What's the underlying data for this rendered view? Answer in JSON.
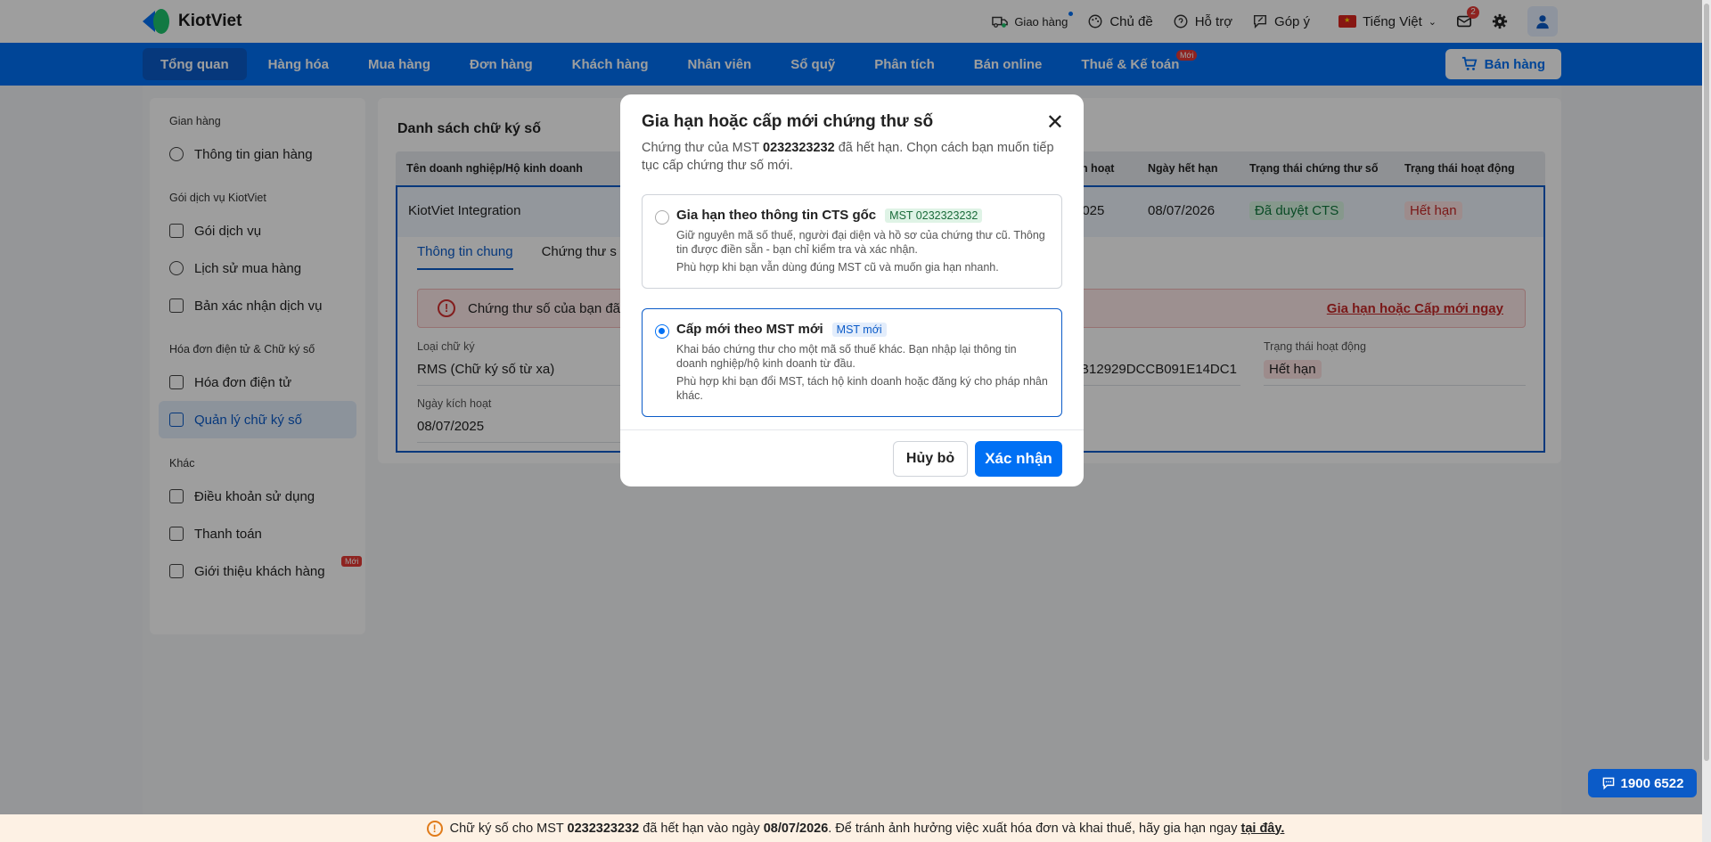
{
  "header": {
    "logo_text": "KiotViet",
    "delivery_label": "Giao hàng",
    "theme_label": "Chủ đề",
    "support_label": "Hỗ trợ",
    "feedback_label": "Góp ý",
    "language_label": "Tiếng Việt",
    "mail_count": "2"
  },
  "nav": {
    "items": [
      {
        "label": "Tổng quan"
      },
      {
        "label": "Hàng hóa"
      },
      {
        "label": "Mua hàng"
      },
      {
        "label": "Đơn hàng"
      },
      {
        "label": "Khách hàng"
      },
      {
        "label": "Nhân viên"
      },
      {
        "label": "Sổ quỹ"
      },
      {
        "label": "Phân tích"
      },
      {
        "label": "Bán online"
      },
      {
        "label": "Thuế & Kế toán",
        "badge": "Mới"
      }
    ],
    "sell_button": "Bán hàng"
  },
  "sidebar": {
    "groups": [
      {
        "title": "Gian hàng",
        "items": [
          "Thông tin gian hàng"
        ]
      },
      {
        "title": "Gói dịch vụ KiotViet",
        "items": [
          "Gói dịch vụ",
          "Lịch sử mua hàng",
          "Bản xác nhận dịch vụ"
        ]
      },
      {
        "title": "Hóa đơn điện tử & Chữ ký số",
        "items": [
          "Hóa đơn điện tử",
          "Quản lý chữ ký số"
        ]
      },
      {
        "title": "Khác",
        "items": [
          "Điều khoản sử dụng",
          "Thanh toán",
          "Giới thiệu khách hàng"
        ]
      }
    ],
    "new_badge": "Mới"
  },
  "main": {
    "title": "Danh sách chữ ký số",
    "columns": {
      "company": "Tên doanh nghiệp/Hộ kinh doanh",
      "activated": "ch hoạt",
      "expiry": "Ngày hết hạn",
      "cert_status": "Trạng thái chứng thư số",
      "active_status": "Trạng thái hoạt động"
    },
    "row": {
      "company": "KiotViet Integration",
      "activated": "2025",
      "expiry": "08/07/2026",
      "cert_status": "Đã duyệt CTS",
      "active_status": "Hết hạn"
    },
    "tabs": [
      "Thông tin chung",
      "Chứng thư s"
    ],
    "alert_text": "Chứng thư số của bạn đã",
    "alert_link": "Gia hạn hoặc Cấp mới ngay",
    "fields": {
      "type_label": "Loại chữ ký",
      "type_value": "RMS (Chữ ký số từ xa)",
      "serial_value": "B12929DCCB091E14DC1",
      "status_label": "Trạng thái hoạt động",
      "status_value": "Hết hạn",
      "activated_label": "Ngày kích hoạt",
      "activated_value": "08/07/2025"
    }
  },
  "modal": {
    "title": "Gia hạn hoặc cấp mới chứng thư số",
    "desc_prefix": "Chứng thư của MST ",
    "desc_mst": "0232323232",
    "desc_suffix": " đã hết hạn. Chọn cách bạn muốn tiếp tục cấp chứng thư số mới.",
    "option1": {
      "title": "Gia hạn theo thông tin CTS gốc",
      "tag": "MST 0232323232",
      "text": "Giữ nguyên mã số thuế, người đại diện và hồ sơ của chứng thư cũ. Thông tin được điền sẵn - bạn chỉ kiểm tra và xác nhận.",
      "note": "Phù hợp khi bạn vẫn dùng đúng MST cũ và muốn gia hạn nhanh.",
      "selected": false
    },
    "option2": {
      "title": "Cấp mới theo MST mới",
      "tag": "MST mới",
      "text": "Khai báo chứng thư cho một mã số thuế khác. Bạn nhập lại thông tin doanh nghiệp/hộ kinh doanh từ đầu.",
      "note": "Phù hợp khi bạn đổi MST, tách hộ kinh doanh hoặc đăng ký cho pháp nhân khác.",
      "selected": true
    },
    "cancel_label": "Hủy bỏ",
    "confirm_label": "Xác nhận"
  },
  "warning_bar": {
    "prefix": "Chữ ký số cho MST ",
    "mst": "0232323232",
    "middle": " đã hết hạn vào ngày ",
    "date": "08/07/2026",
    "suffix": ". Để tránh ảnh hưởng việc xuất hóa đơn và khai thuế, hãy gia hạn ngay ",
    "link": "tại đây."
  },
  "hotline": "1900 6522",
  "colors": {
    "primary": "#0070f4",
    "danger": "#c62828",
    "success": "#117a3e"
  }
}
